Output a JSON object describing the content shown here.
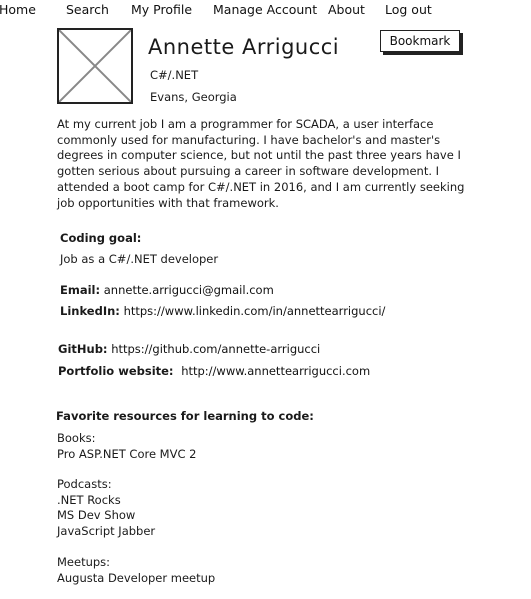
{
  "nav": {
    "items": [
      {
        "label": "Home"
      },
      {
        "label": "Search"
      },
      {
        "label": "My Profile"
      },
      {
        "label": "Manage Account"
      },
      {
        "label": "About"
      },
      {
        "label": "Log out"
      }
    ]
  },
  "profile": {
    "name": "Annette Arrigucci",
    "tech": "C#/.NET",
    "location": "Evans, Georgia",
    "bookmark_label": "Bookmark",
    "bio": "At my current job I am a programmer for SCADA, a user interface commonly used for manufacturing. I have bachelor's and master's degrees in computer science, but not until the past three years have I gotten serious about pursuing a career in software development. I attended a boot camp for C#/.NET in 2016, and I am currently seeking job opportunities with that framework."
  },
  "coding_goal": {
    "label": "Coding goal:",
    "value": "Job as a C#/.NET developer"
  },
  "contact": {
    "email_label": "Email:",
    "email": "annette.arrigucci@gmail.com",
    "linkedin_label": "LinkedIn:",
    "linkedin": "https://www.linkedin.com/in/annettearrigucci/",
    "github_label": "GitHub:",
    "github": "https://github.com/annette-arrigucci",
    "portfolio_label": "Portfolio website:",
    "portfolio": "http://www.annettearrigucci.com"
  },
  "resources": {
    "title": "Favorite resources for learning to code:",
    "books": "Books:\nPro ASP.NET Core MVC 2",
    "podcasts": "Podcasts:\n.NET Rocks\nMS Dev Show\nJavaScript Jabber",
    "meetups": "Meetups:\nAugusta Developer meetup"
  }
}
